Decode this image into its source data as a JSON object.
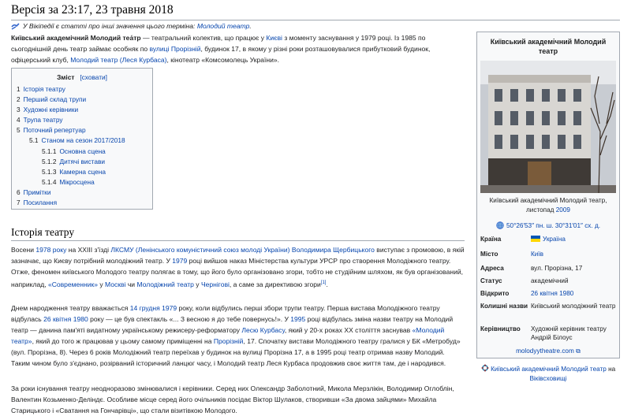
{
  "page": {
    "title": "Версія за 23:17, 23 травня 2018",
    "hatnote": {
      "prefix": "У Вікіпедії є статті про інші значення цього терміна: ",
      "link": "Молодий театр",
      "suffix": "."
    }
  },
  "intro": {
    "bold": "Київський академічний Молодий теа́тр",
    "t1": " — театральний колектив, що працює у ",
    "l1": "Києві",
    "t2": " з моменту заснування у 1979 році. Із 1985 по сьогоднішній день театр займає особняк по ",
    "l2": "вулиці Прорізній",
    "t3": ", будинок 17, в якому у різні роки розташовувалися прибутковий будинок, офіцерський клуб, ",
    "l3": "Молодий театр (Леся Курбаса)",
    "t4": ", кінотеатр «Комсомолець України»."
  },
  "toc": {
    "title": "Зміст",
    "toggle": "[сховати]",
    "items": [
      {
        "num": "1",
        "label": "Історія театру"
      },
      {
        "num": "2",
        "label": "Перший склад трупи"
      },
      {
        "num": "3",
        "label": "Художні керівники"
      },
      {
        "num": "4",
        "label": "Трупа театру"
      },
      {
        "num": "5",
        "label": "Поточний репертуар"
      },
      {
        "num": "5.1",
        "label": "Станом на сезон 2017/2018"
      },
      {
        "num": "5.1.1",
        "label": "Основна сцена"
      },
      {
        "num": "5.1.2",
        "label": "Дитячі вистави"
      },
      {
        "num": "5.1.3",
        "label": "Камерна сцена"
      },
      {
        "num": "5.1.4",
        "label": "Мікросцена"
      },
      {
        "num": "6",
        "label": "Примітки"
      },
      {
        "num": "7",
        "label": "Посилання"
      }
    ]
  },
  "history": {
    "heading": "Історія театру",
    "p1": {
      "t1": "Восени ",
      "l1": "1978 року",
      "t2": " на XXIII з'їзді ",
      "l2": "ЛКСМУ (Ленінського комуністичний союз молоді України)",
      "t3": " ",
      "l3": "Володимира Щербицького",
      "t4": " виступає з промовою, в якій зазначає, що Києву потрібний молодіжний театр. У ",
      "l4": "1979",
      "t5": " році вийшов наказ Міністерства культури УРСР про створення Молодіжного театру. Отже, феномен київського Молодого театру полягає в тому, що його було організовано згори, тобто не студійним шляхом, як був організований, наприклад, ",
      "l5": "«Современник»",
      "t6": " у ",
      "l6": "Москві",
      "t7": " чи ",
      "l7": "Молодіжний театр",
      "t8": " у ",
      "l8": "Чернігові",
      "t9": ", а саме за директивою згори",
      "ref": "[1]",
      "t10": "."
    },
    "p2": {
      "t1": "Днем народження театру вважається ",
      "l1": "14 грудня 1979",
      "t2": " року, коли відбулись перші збори трупи театру. Перша вистава Молодіжного театру відбулась ",
      "l2": "26 квітня 1980",
      "t3": " року — це був спектакль «... З весною я до тебе повернусь!». У ",
      "l3": "1995",
      "t4": " році відбулась зміна назви театру на Молодий театр — данина пам'яті видатному українському режисеру-реформатору ",
      "l4": "Лесю Курбасу",
      "t5": ", який у 20-х роках XX століття заснував ",
      "l5": "«Молодий театр»",
      "t6": ", який до того ж працював у цьому самому приміщенні на ",
      "l6": "Прорізній",
      "t7": ", 17. Спочатку вистави Молодіжного театру гралися у БК «Метробуд» (вул. Прорізна, 8). Через 6 років Молодіжний театр переїхав у будинок на вулиці Прорізна 17, а в 1995 році театр отримав назву Молодий. Таким чином було з'єднано, розірваний історичний ланцюг часу, і Молодий театр Леся Курбаса продовжив своє життя там, де і народився."
    },
    "p3": "За роки існування театру неодноразово змінювалися і керівники. Серед них Олександр Заболотний, Микола Мерзлікін, Володимир Оглоблін, Валентин Козьменко-Деліндє. Особливе місце серед його очільників посідає Віктор Шулаков, створивши «За двома зайцями» Михайла Старицького і «Сватання на Гончарівці», що стали візитівкою Молодого."
  },
  "infobox": {
    "title": "Київський академічний Молодий театр",
    "caption_text": "Київський академічний Молодий театр, листопад ",
    "caption_link": "2009",
    "coords": "50°26′53″ пн. ш. 30°31′01″ сх. д.",
    "rows": [
      {
        "key": "Країна",
        "value": "Україна"
      },
      {
        "key": "Місто",
        "value": "Київ"
      },
      {
        "key": "Адреса",
        "value": "вул. Прорізна, 17"
      },
      {
        "key": "Статус",
        "value": "академічний"
      },
      {
        "key": "Відкрито",
        "value": "26 квітня 1980"
      },
      {
        "key": "Колишні назви",
        "value": "Київський молодіжний театр"
      },
      {
        "key": "Керівництво",
        "value": "Художній керівник театру Андрій Білоус"
      }
    ],
    "website": "molodyytheatre.com",
    "commons_link": "Київський академічний Молодий театр",
    "commons_middle": " на ",
    "commons_site": "Віківсховищі"
  },
  "colors": {
    "link": "#0645ad",
    "border": "#a2a9b1",
    "box_bg": "#f8f9fa"
  }
}
